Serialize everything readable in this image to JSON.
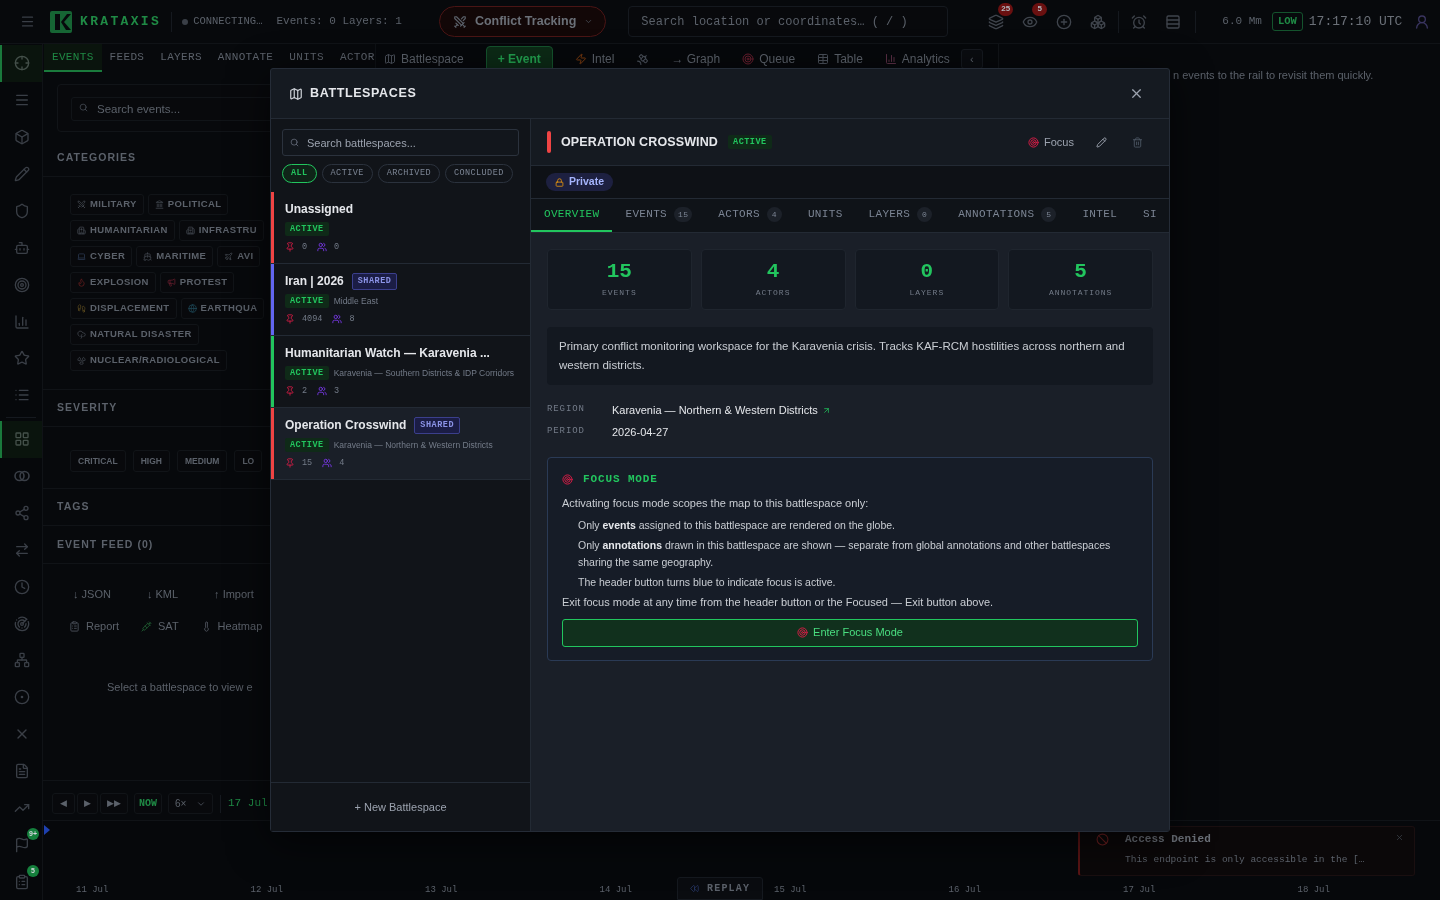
{
  "topbar": {
    "brand": "KRATAXIS",
    "status": "CONNECTING…",
    "counts": "Events: 0 Layers: 1",
    "mode": "Conflict Tracking",
    "search_placeholder": "Search location or coordinates… ( / )",
    "icon_badges": [
      "25",
      "5"
    ],
    "scale": "6.0 Mm",
    "threat": "LOW",
    "clock": "17:17:10 UTC"
  },
  "rail": [
    {
      "selected": true
    },
    {
      "selected": false
    },
    {
      "selected": false
    },
    {
      "selected": false
    },
    {
      "selected": false
    },
    {
      "selected": false
    },
    {
      "selected": false
    },
    {
      "selected": false
    },
    {
      "selected": false
    },
    {
      "selected": false
    },
    {
      "selected": true
    },
    {
      "selected": false
    },
    {
      "selected": false
    },
    {
      "selected": false
    },
    {
      "selected": false
    },
    {
      "selected": false
    },
    {
      "selected": false
    },
    {
      "selected": false
    },
    {
      "selected": false
    },
    {
      "selected": false
    },
    {
      "selected": false
    },
    {
      "selected": false,
      "badge": "9+"
    },
    {
      "selected": false,
      "badge": "5"
    }
  ],
  "panel": {
    "tabs": [
      {
        "label": "EVENTS",
        "selected": true
      },
      {
        "label": "FEEDS",
        "selected": false
      },
      {
        "label": "LAYERS",
        "selected": false
      },
      {
        "label": "ANNOTATE",
        "selected": false
      },
      {
        "label": "UNITS",
        "selected": false
      },
      {
        "label": "ACTOR",
        "selected": false
      }
    ],
    "search_placeholder": "Search events...",
    "categories_title": "CATEGORIES",
    "category_rows": [
      [
        "MILITARY",
        "POLITICAL"
      ],
      [
        "HUMANITARIAN",
        "INFRASTRU"
      ],
      [
        "CYBER",
        "MARITIME",
        "AVI"
      ],
      [
        "EXPLOSION",
        "PROTEST"
      ],
      [
        "DISPLACEMENT",
        "EARTHQUA"
      ],
      [
        "NATURAL DISASTER"
      ],
      [
        "NUCLEAR/RADIOLOGICAL"
      ]
    ],
    "severity_title": "SEVERITY",
    "severities": [
      "CRITICAL",
      "HIGH",
      "MEDIUM",
      "LO"
    ],
    "tags_title": "TAGS",
    "feed_title": "EVENT FEED (0)",
    "exports": [
      "↓ JSON",
      "↓ KML",
      "↑ Import"
    ],
    "tools": [
      "Report",
      "SAT",
      "Heatmap"
    ],
    "empty": "Select a battlespace to view e",
    "playback": {
      "controls": [
        "◀",
        "▶",
        "▶▶"
      ],
      "now": "NOW",
      "speed": "6×",
      "date": "17 Jul"
    }
  },
  "toolbar": {
    "items": [
      {
        "kind": "tool",
        "label": "Battlespace"
      },
      {
        "kind": "primary",
        "label": "+ Event"
      },
      {
        "kind": "tool",
        "label": "Intel"
      },
      {
        "kind": "icon"
      },
      {
        "kind": "tool",
        "label": "→ Graph"
      },
      {
        "kind": "tool",
        "label": "Queue"
      },
      {
        "kind": "tool",
        "label": "Table"
      },
      {
        "kind": "tool",
        "label": "Analytics"
      }
    ],
    "collapse": "‹"
  },
  "side_hint": "n events to the rail to revisit them quickly.",
  "timeline": {
    "ticks": [
      "11 Jul",
      "12 Jul",
      "13 Jul",
      "14 Jul",
      "15 Jul",
      "16 Jul",
      "17 Jul",
      "18 Jul"
    ],
    "replay": "REPLAY"
  },
  "toast": {
    "title": "Access Denied",
    "message": "This endpoint is only accessible in the […"
  },
  "modal": {
    "title": "BATTLESPACES",
    "search_placeholder": "Search battlespaces...",
    "filters": [
      {
        "label": "ALL",
        "selected": true
      },
      {
        "label": "ACTIVE",
        "selected": false
      },
      {
        "label": "ARCHIVED",
        "selected": false
      },
      {
        "label": "CONCLUDED",
        "selected": false
      }
    ],
    "items": [
      {
        "name": "Unassigned",
        "color": "#ef4444",
        "status": "ACTIVE",
        "events": "0",
        "actors": "0",
        "selected": false
      },
      {
        "name": "Iran | 2026",
        "shared": "SHARED",
        "color": "#6366f1",
        "status": "ACTIVE",
        "region": "Middle East",
        "events": "4094",
        "actors": "8",
        "selected": false
      },
      {
        "name": "Humanitarian Watch — Karavenia ...",
        "color": "#22c55e",
        "status": "ACTIVE",
        "region": "Karavenia — Southern Districts & IDP Corridors",
        "events": "2",
        "actors": "3",
        "selected": false
      },
      {
        "name": "Operation Crosswind",
        "shared": "SHARED",
        "color": "#ef4444",
        "status": "ACTIVE",
        "region": "Karavenia — Northern & Western Districts",
        "events": "15",
        "actors": "4",
        "selected": true
      }
    ],
    "new_button": "+ New Battlespace",
    "detail": {
      "color": "#ef4444",
      "title": "OPERATION CROSSWIND",
      "status": "ACTIVE",
      "focus": "Focus",
      "visibility": "Private",
      "tabs": [
        {
          "label": "OVERVIEW",
          "selected": true
        },
        {
          "label": "EVENTS",
          "count": "15",
          "selected": false
        },
        {
          "label": "ACTORS",
          "count": "4",
          "selected": false
        },
        {
          "label": "UNITS",
          "selected": false
        },
        {
          "label": "LAYERS",
          "count": "0",
          "selected": false
        },
        {
          "label": "ANNOTATIONS",
          "count": "5",
          "selected": false
        },
        {
          "label": "INTEL",
          "selected": false
        },
        {
          "label": "SI",
          "selected": false
        }
      ],
      "stats": [
        {
          "value": "15",
          "label": "EVENTS"
        },
        {
          "value": "4",
          "label": "ACTORS"
        },
        {
          "value": "0",
          "label": "LAYERS"
        },
        {
          "value": "5",
          "label": "ANNOTATIONS"
        }
      ],
      "description": "Primary conflict monitoring workspace for the Karavenia crisis. Tracks KAF-RCM hostilities across northern and western districts.",
      "fields": [
        {
          "kind": "link",
          "label": "REGION",
          "value": "Karavenia — Northern & Western Districts"
        },
        {
          "kind": "text",
          "label": "PERIOD",
          "value": "2026-04-27"
        }
      ],
      "focus_mode": {
        "title": "FOCUS MODE",
        "intro": "Activating focus mode scopes the map to this battlespace only:",
        "points": [
          "Only **events** assigned to this battlespace are rendered on the globe.",
          "Only **annotations** drawn in this battlespace are shown — separate from global annotations and other battlespaces sharing the same geography.",
          "The header button turns blue to indicate focus is active."
        ],
        "outro": "Exit focus mode at any time from the header button or the Focused — Exit button above.",
        "button": "Enter Focus Mode"
      }
    }
  }
}
